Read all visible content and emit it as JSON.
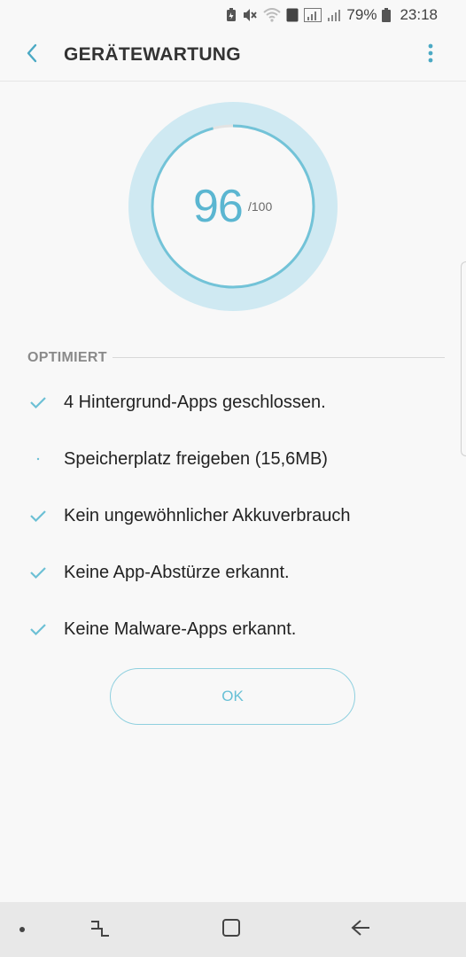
{
  "status_bar": {
    "battery_percent": "79%",
    "time": "23:18",
    "sim_badge": "1",
    "icons": [
      "battery-saver-icon",
      "mute-icon",
      "wifi-icon",
      "sim-icon",
      "signal-icon",
      "battery-icon"
    ]
  },
  "header": {
    "title": "GERÄTEWARTUNG",
    "icons": [
      "back-arrow-icon",
      "more-vert-icon"
    ]
  },
  "score": {
    "value": "96",
    "max_label": "/100",
    "fraction": 0.96,
    "accent_color": "#5bb6d1",
    "ring_color": "#cfe9f2"
  },
  "section": {
    "label": "OPTIMIERT"
  },
  "items": [
    {
      "text": "4 Hintergrund-Apps geschlossen.",
      "status": "check"
    },
    {
      "text": "Speicherplatz freigeben (15,6MB)",
      "status": "pending"
    },
    {
      "text": "Kein ungewöhnlicher Akkuverbrauch",
      "status": "check"
    },
    {
      "text": "Keine App-Abstürze erkannt.",
      "status": "check"
    },
    {
      "text": "Keine Malware-Apps erkannt.",
      "status": "check"
    }
  ],
  "ok_button": {
    "label": "OK"
  },
  "nav_bar": {
    "icons": [
      "recents-icon",
      "home-icon",
      "back-icon"
    ]
  }
}
